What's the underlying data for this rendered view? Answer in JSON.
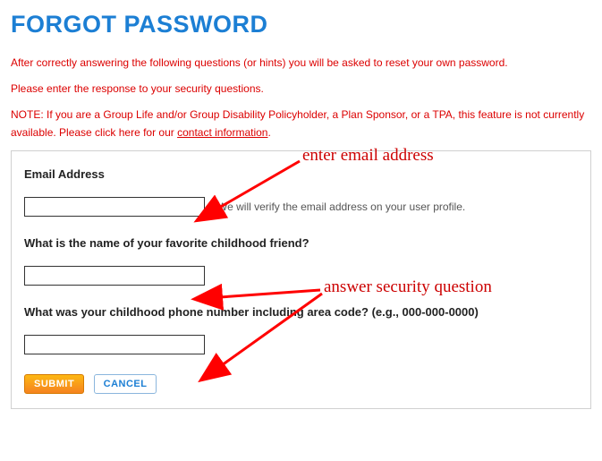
{
  "title": "FORGOT PASSWORD",
  "instructions": {
    "line1": "After correctly answering the following questions (or hints) you will be asked to reset your own password.",
    "line2": "Please enter the response to your security questions.",
    "note_prefix": "NOTE: If you are a Group Life and/or Group Disability Policyholder, a Plan Sponsor, or a TPA, this feature is not currently available. Please click here for our ",
    "contact_link": "contact information",
    "note_suffix": "."
  },
  "form": {
    "email_label": "Email Address",
    "email_value": "",
    "email_helper": "We will verify the email address on your user profile.",
    "question1_label": "What is the name of your favorite childhood friend?",
    "question1_value": "",
    "question2_label": "What was your childhood phone number including area code? (e.g., 000-000-0000)",
    "question2_value": "",
    "submit_label": "SUBMIT",
    "cancel_label": "CANCEL"
  },
  "annotations": {
    "a1": "enter email address",
    "a2": "answer security question"
  }
}
